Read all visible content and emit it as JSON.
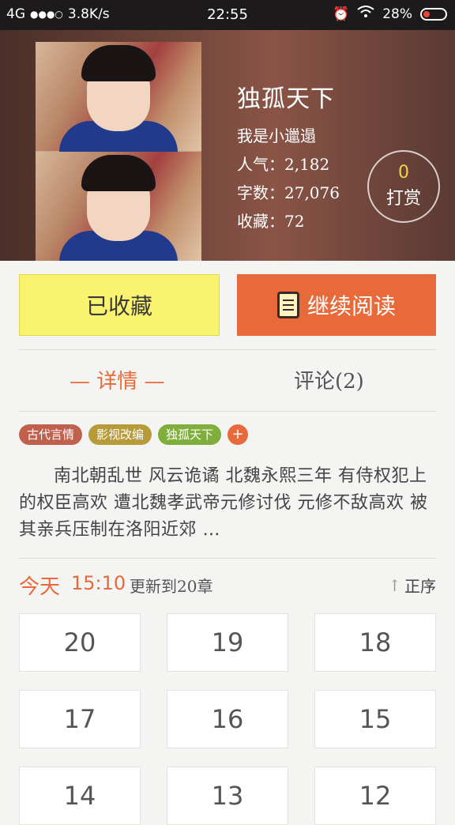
{
  "status_bar": {
    "network": "4G",
    "signal": "●●●○",
    "speed": "3.8K/s",
    "time": "22:55",
    "battery": "28%"
  },
  "book": {
    "title": "独孤天下",
    "author": "我是小邋遢",
    "popularity": "人气：2,182",
    "word_count": "字数：27,076",
    "favorites": "收藏：72"
  },
  "tip": {
    "count": "0",
    "label": "打赏"
  },
  "actions": {
    "collected_label": "已收藏",
    "continue_label": "继续阅读"
  },
  "tabs": {
    "details": "— 详情 —",
    "comments": "评论(2)"
  },
  "tags": [
    "古代言情",
    "影视改编",
    "独孤天下",
    "+"
  ],
  "synopsis": "南北朝乱世 风云诡谲 北魏永熙三年 有侍权犯上的权臣高欢 遭北魏孝武帝元修讨伐 元修不敌高欢 被其亲兵压制在洛阳近郊 …",
  "update": {
    "day": "今天",
    "time": "15:10",
    "text": "更新到20章",
    "order_label": "正序"
  },
  "chapters": [
    "20",
    "19",
    "18",
    "17",
    "16",
    "15",
    "14",
    "13",
    "12"
  ],
  "colors": {
    "accent": "#e8693a",
    "collect_button": "#faf36f",
    "tag_ancient": "#c0614e",
    "tag_adapted": "#b79a3a",
    "tag_title": "#7fae3a"
  }
}
